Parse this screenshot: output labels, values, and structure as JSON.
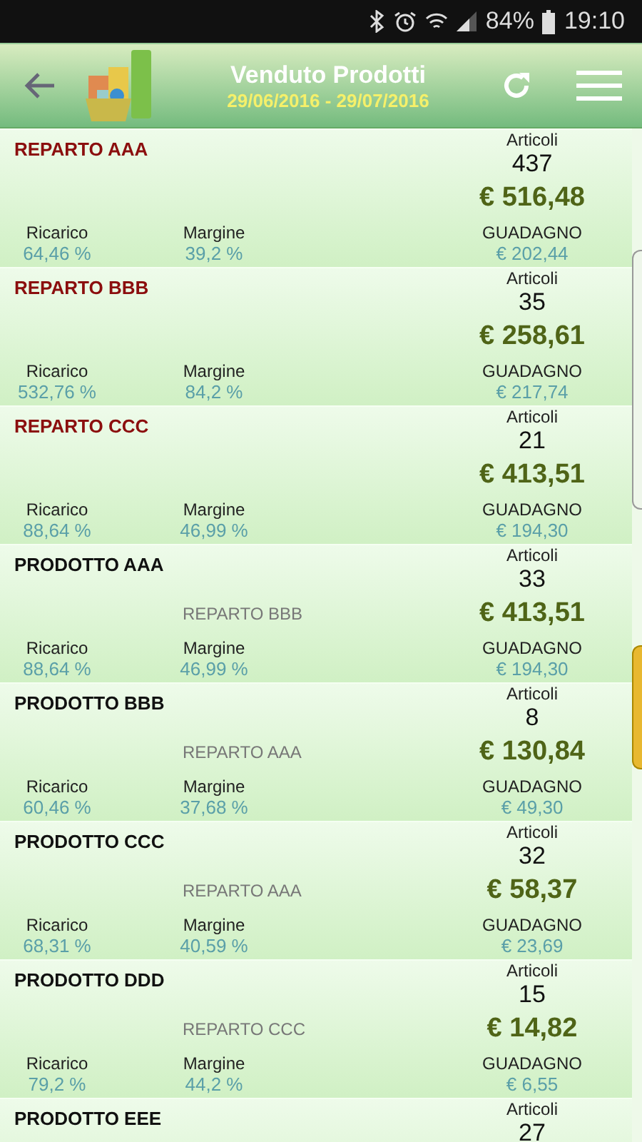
{
  "status_bar": {
    "battery": "84%",
    "time": "19:10"
  },
  "app_bar": {
    "title": "Venduto Prodotti",
    "subtitle": "29/06/2016 - 29/07/2016"
  },
  "rows": [
    {
      "kind": "reparto",
      "name": "REPARTO AAA",
      "articoli_label": "Articoli",
      "articoli": "437",
      "amount": "€ 516,48",
      "ricarico_label": "Ricarico",
      "ricarico": "64,46 %",
      "margine_label": "Margine",
      "margine": "39,2 %",
      "guadagno_label": "GUADAGNO",
      "guadagno": "€ 202,44"
    },
    {
      "kind": "reparto",
      "name": "REPARTO BBB",
      "articoli_label": "Articoli",
      "articoli": "35",
      "amount": "€ 258,61",
      "ricarico_label": "Ricarico",
      "ricarico": "532,76 %",
      "margine_label": "Margine",
      "margine": "84,2 %",
      "guadagno_label": "GUADAGNO",
      "guadagno": "€ 217,74"
    },
    {
      "kind": "reparto",
      "name": "REPARTO CCC",
      "articoli_label": "Articoli",
      "articoli": "21",
      "amount": "€ 413,51",
      "ricarico_label": "Ricarico",
      "ricarico": "88,64 %",
      "margine_label": "Margine",
      "margine": "46,99 %",
      "guadagno_label": "GUADAGNO",
      "guadagno": "€ 194,30"
    },
    {
      "kind": "prodotto",
      "name": "PRODOTTO AAA",
      "reparto": "REPARTO BBB",
      "articoli_label": "Articoli",
      "articoli": "33",
      "amount": "€ 413,51",
      "ricarico_label": "Ricarico",
      "ricarico": "88,64 %",
      "margine_label": "Margine",
      "margine": "46,99 %",
      "guadagno_label": "GUADAGNO",
      "guadagno": "€ 194,30"
    },
    {
      "kind": "prodotto",
      "name": "PRODOTTO BBB",
      "reparto": "REPARTO AAA",
      "articoli_label": "Articoli",
      "articoli": "8",
      "amount": "€ 130,84",
      "ricarico_label": "Ricarico",
      "ricarico": "60,46 %",
      "margine_label": "Margine",
      "margine": "37,68 %",
      "guadagno_label": "GUADAGNO",
      "guadagno": "€ 49,30"
    },
    {
      "kind": "prodotto",
      "name": "PRODOTTO CCC",
      "reparto": "REPARTO AAA",
      "articoli_label": "Articoli",
      "articoli": "32",
      "amount": "€ 58,37",
      "ricarico_label": "Ricarico",
      "ricarico": "68,31 %",
      "margine_label": "Margine",
      "margine": "40,59 %",
      "guadagno_label": "GUADAGNO",
      "guadagno": "€ 23,69"
    },
    {
      "kind": "prodotto",
      "name": "PRODOTTO DDD",
      "reparto": "REPARTO CCC",
      "articoli_label": "Articoli",
      "articoli": "15",
      "amount": "€ 14,82",
      "ricarico_label": "Ricarico",
      "ricarico": "79,2 %",
      "margine_label": "Margine",
      "margine": "44,2 %",
      "guadagno_label": "GUADAGNO",
      "guadagno": "€ 6,55"
    },
    {
      "kind": "prodotto",
      "name": "PRODOTTO EEE",
      "articoli_label": "Articoli",
      "articoli": "27"
    }
  ]
}
